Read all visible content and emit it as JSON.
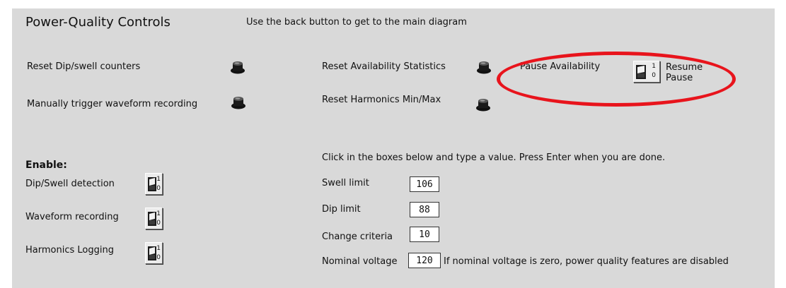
{
  "title": "Power-Quality Controls",
  "back_hint": "Use the back button to get to the main diagram",
  "buttons": {
    "reset_dip_swell": "Reset Dip/swell counters",
    "trigger_waveform": "Manually trigger waveform recording",
    "reset_availability": "Reset Availability Statistics",
    "reset_harmonics": "Reset Harmonics Min/Max"
  },
  "pause": {
    "label": "Pause Availability",
    "state_on": "Resume",
    "state_off": "Pause",
    "toggle_on": "1",
    "toggle_off": "0"
  },
  "enable": {
    "heading": "Enable:",
    "items": [
      {
        "label": "Dip/Swell detection",
        "on": "1",
        "off": "0"
      },
      {
        "label": "Waveform recording",
        "on": "1",
        "off": "0"
      },
      {
        "label": "Harmonics Logging",
        "on": "1",
        "off": "0"
      }
    ]
  },
  "limits": {
    "instruction": "Click in the boxes below and type a value. Press Enter when you are done.",
    "swell_label": "Swell limit",
    "swell_value": "106",
    "dip_label": "Dip limit",
    "dip_value": "88",
    "change_label": "Change criteria",
    "change_value": "10",
    "nominal_label": "Nominal voltage",
    "nominal_value": "120",
    "nominal_note": "If nominal voltage is zero, power quality features are disabled"
  },
  "colors": {
    "panel": "#d9d9d9",
    "highlight_oval": "#e8141c"
  },
  "icons": {
    "push_button": "black-push-button-icon",
    "toggle_switch": "toggle-switch-icon"
  }
}
